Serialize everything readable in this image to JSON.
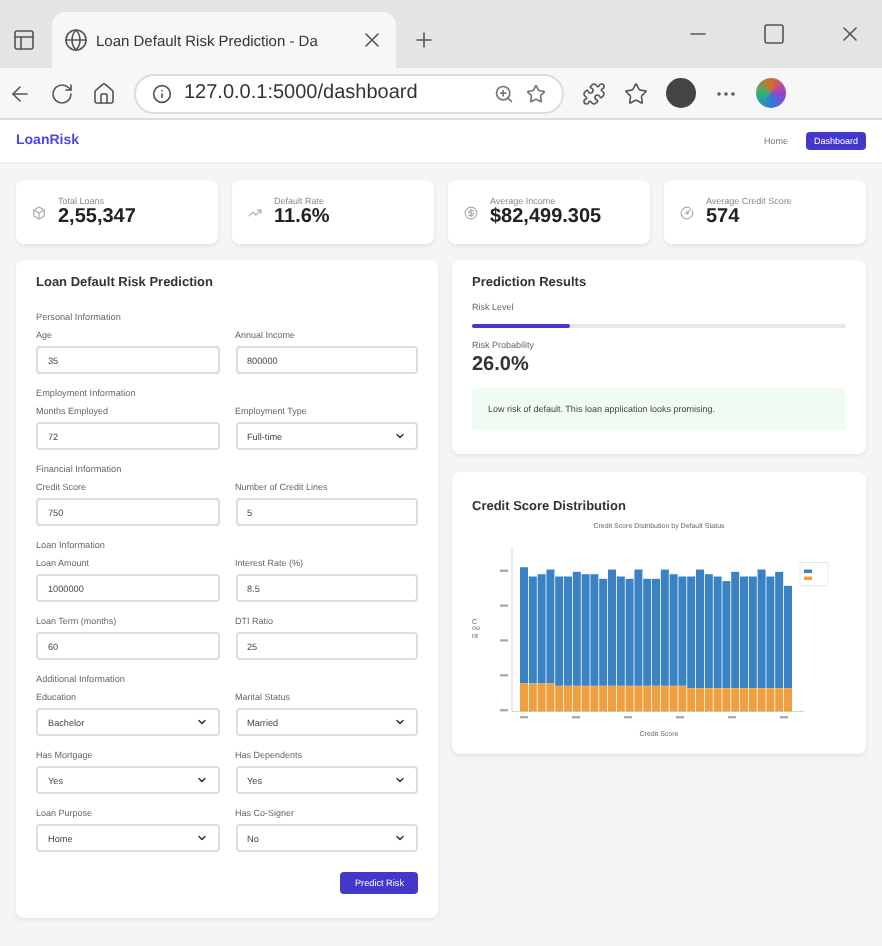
{
  "browser": {
    "tab_title": "Loan Default Risk Prediction - Da",
    "url": "127.0.0.1:5000/dashboard"
  },
  "nav": {
    "brand": "LoanRisk",
    "links": [
      {
        "label": "Home",
        "selected": false
      },
      {
        "label": "Dashboard",
        "selected": true
      }
    ]
  },
  "stats": [
    {
      "kind": "loans",
      "label": "Total Loans",
      "value": "2,55,347"
    },
    {
      "kind": "rate",
      "label": "Default Rate",
      "value": "11.6%"
    },
    {
      "kind": "income",
      "label": "Average Income",
      "value": "$82,499.305"
    },
    {
      "kind": "score",
      "label": "Average Credit Score",
      "value": "574"
    }
  ],
  "form": {
    "title": "Loan Default Risk Prediction",
    "sections": [
      {
        "title": "Personal Information",
        "fields": [
          {
            "label": "Age",
            "kind": "input",
            "value": "35"
          },
          {
            "label": "Annual Income",
            "kind": "input",
            "value": "800000"
          }
        ]
      },
      {
        "title": "Employment Information",
        "fields": [
          {
            "label": "Months Employed",
            "kind": "input",
            "value": "72"
          },
          {
            "label": "Employment Type",
            "kind": "select",
            "value": "Full-time"
          }
        ]
      },
      {
        "title": "Financial Information",
        "fields": [
          {
            "label": "Credit Score",
            "kind": "input",
            "value": "750"
          },
          {
            "label": "Number of Credit Lines",
            "kind": "input",
            "value": "5"
          }
        ]
      },
      {
        "title": "Loan Information",
        "fields": [
          {
            "label": "Loan Amount",
            "kind": "input",
            "value": "1000000"
          },
          {
            "label": "Interest Rate (%)",
            "kind": "input",
            "value": "8.5"
          },
          {
            "label": "Loan Term (months)",
            "kind": "input",
            "value": "60"
          },
          {
            "label": "DTI Ratio",
            "kind": "input",
            "value": "25"
          }
        ]
      },
      {
        "title": "Additional Information",
        "fields": [
          {
            "label": "Education",
            "kind": "select",
            "value": "Bachelor"
          },
          {
            "label": "Marital Status",
            "kind": "select",
            "value": "Married"
          },
          {
            "label": "Has Mortgage",
            "kind": "select",
            "value": "Yes"
          },
          {
            "label": "Has Dependents",
            "kind": "select",
            "value": "Yes"
          },
          {
            "label": "Loan Purpose",
            "kind": "select",
            "value": "Home"
          },
          {
            "label": "Has Co-Signer",
            "kind": "select",
            "value": "No"
          }
        ]
      }
    ],
    "button": "Predict Risk"
  },
  "results": {
    "title": "Prediction Results",
    "risk_label": "Risk Level",
    "level": 0.26,
    "probability_label": "Risk Probability",
    "probability": "26.0%",
    "message": "Low risk of default. This loan application looks promising."
  },
  "chart_card": {
    "title": "Credit Score Distribution",
    "chart_title": "Credit Score Distribution by Default Status",
    "xlabel": "Credit Score",
    "ylabel": "Count"
  }
}
